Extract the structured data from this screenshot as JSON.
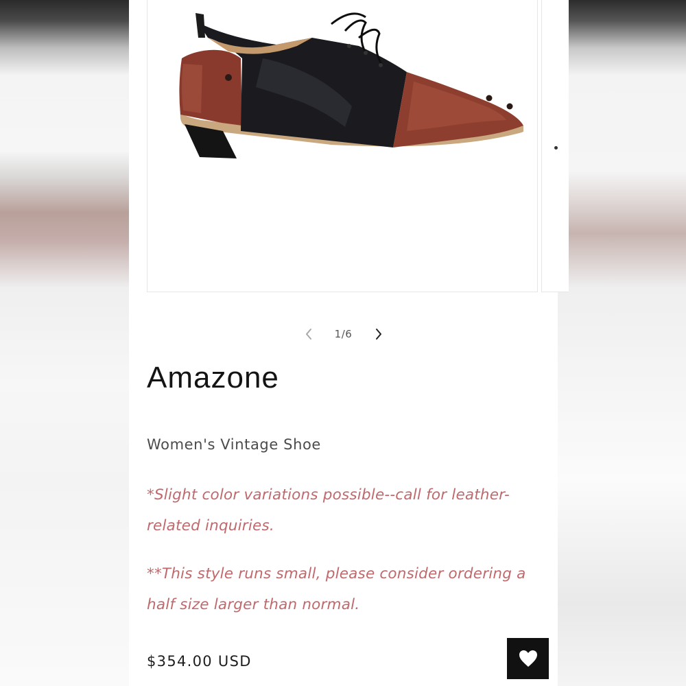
{
  "gallery": {
    "counter": "1/6",
    "image_alt": "Amazone women's vintage shoe, black and burgundy leather lace-up"
  },
  "product": {
    "title": "Amazone",
    "subtitle": "Women's Vintage Shoe",
    "note_color": "Slight color variations possible--call for leather-related inquiries.",
    "note_color_full": "*Slight color variations possible--call for leather-related inquiries.",
    "note_size_full": "**This style runs small, please consider ordering a half size larger than normal.",
    "price": "$354.00 USD"
  },
  "icons": {
    "prev": "chevron-left-icon",
    "next": "chevron-right-icon",
    "wishlist": "heart-icon"
  },
  "colors": {
    "note": "#c0696d",
    "wishlist_bg": "#111111",
    "title": "#141414"
  }
}
